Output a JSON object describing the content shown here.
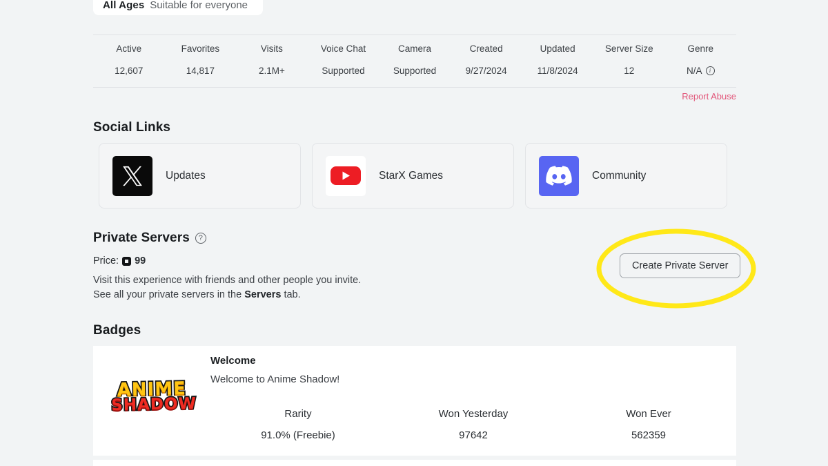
{
  "age_card": {
    "label": "All Ages",
    "description": "Suitable for everyone"
  },
  "stats": {
    "columns": [
      {
        "key": "Active",
        "value": "12,607"
      },
      {
        "key": "Favorites",
        "value": "14,817"
      },
      {
        "key": "Visits",
        "value": "2.1M+"
      },
      {
        "key": "Voice Chat",
        "value": "Supported"
      },
      {
        "key": "Camera",
        "value": "Supported"
      },
      {
        "key": "Created",
        "value": "9/27/2024"
      },
      {
        "key": "Updated",
        "value": "11/8/2024"
      },
      {
        "key": "Server Size",
        "value": "12"
      },
      {
        "key": "Genre",
        "value": "N/A",
        "info_icon": "info-icon"
      }
    ]
  },
  "report_abuse": {
    "label": "Report Abuse",
    "color": "#e2567a"
  },
  "social_links": {
    "title": "Social Links",
    "cards": [
      {
        "label": "Updates",
        "icon": "x-twitter-icon",
        "icon_bg": "#0a0a0a"
      },
      {
        "label": "StarX Games",
        "icon": "youtube-icon",
        "icon_bg": "#ffffff"
      },
      {
        "label": "Community",
        "icon": "discord-icon",
        "icon_bg": "#5865f2"
      }
    ]
  },
  "private_servers": {
    "title": "Private Servers",
    "help_icon": "question-mark-icon",
    "price_label": "Price:",
    "price_icon": "robux-icon",
    "price_amount": "99",
    "description_line1": "Visit this experience with friends and other people you invite.",
    "description_line2_pre": "See all your private servers in the ",
    "description_line2_bold": "Servers",
    "description_line2_post": " tab.",
    "create_button": "Create Private Server"
  },
  "annotation": {
    "type": "ellipse-highlight",
    "color": "#ffe818",
    "target": "Create Private Server"
  },
  "badges": {
    "title": "Badges",
    "items": [
      {
        "icon": "anime-shadow-badge-icon",
        "icon_text_top": "ANIME",
        "icon_text_bottom": "SHADOW",
        "name": "Welcome",
        "description": "Welcome to Anime Shadow!",
        "stats": [
          {
            "key": "Rarity",
            "value": "91.0% (Freebie)"
          },
          {
            "key": "Won Yesterday",
            "value": "97642"
          },
          {
            "key": "Won Ever",
            "value": "562359"
          }
        ]
      }
    ]
  }
}
